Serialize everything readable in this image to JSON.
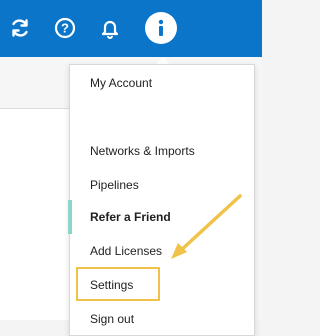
{
  "header": {
    "bg_color": "#0b76c9",
    "icons": [
      "sync-icon",
      "help-icon",
      "notification-bell-icon",
      "user-info-icon"
    ]
  },
  "menu": {
    "items": [
      {
        "label": "My Account"
      },
      {
        "label": "Networks & Imports"
      },
      {
        "label": "Pipelines"
      },
      {
        "label": "Refer a Friend"
      },
      {
        "label": "Add Licenses"
      },
      {
        "label": "Settings"
      },
      {
        "label": "Sign out"
      }
    ]
  },
  "colors": {
    "accent": "#8ad6c9",
    "highlight": "#f0c24a"
  }
}
